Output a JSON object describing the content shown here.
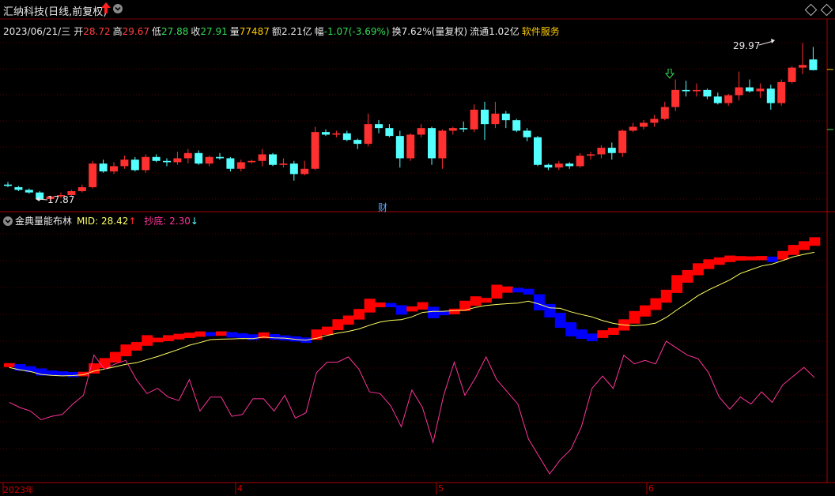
{
  "header": {
    "title": "汇纳科技(日线,前复权)",
    "arrow_up_icon": "red-up-arrow",
    "dropdown_icon": "chevron-down-icon"
  },
  "quote": {
    "date": "2023/06/21/三",
    "open_label": "开",
    "open": "28.72",
    "high_label": "高",
    "high": "29.67",
    "low_label": "低",
    "low": "27.88",
    "close_label": "收",
    "close": "27.91",
    "vol_label": "量",
    "vol": "77487",
    "amount_label": "额",
    "amount": "2.21亿",
    "change_label": "幅",
    "change": "-1.07(-3.69%)",
    "turnover": "换7.62%(量复权)",
    "float": "流通1.02亿",
    "sector": "软件服务"
  },
  "price_chart": {
    "max_label": "29.97",
    "min_label": "17.87",
    "event_badge": "财"
  },
  "indicator": {
    "name": "金典量能布林",
    "mid_label": "MID:",
    "mid_value": "28.42",
    "bottom_label": "抄底:",
    "bottom_value": "2.30"
  },
  "xaxis": {
    "labels": [
      "2023年",
      "4",
      "5",
      "6"
    ]
  },
  "colors": {
    "up": "#ff3030",
    "down": "#54ffff",
    "band_up": "#ff0000",
    "band_down": "#0000ff",
    "mid_line": "#ffff66",
    "bottom_line": "#ff3399",
    "grid": "#5a0000"
  },
  "chart_data": {
    "type": "candlestick",
    "candles": [
      [
        19.2,
        19.4,
        19.0,
        19.1
      ],
      [
        19.0,
        19.1,
        18.7,
        18.8
      ],
      [
        18.8,
        18.9,
        18.5,
        18.6
      ],
      [
        18.6,
        18.7,
        18.0,
        18.1
      ],
      [
        18.1,
        18.3,
        17.87,
        18.3
      ],
      [
        18.3,
        18.6,
        18.2,
        18.4
      ],
      [
        18.4,
        18.8,
        18.3,
        18.7
      ],
      [
        18.7,
        19.2,
        18.6,
        19.0
      ],
      [
        19.0,
        21.0,
        18.9,
        20.8
      ],
      [
        20.8,
        21.1,
        20.1,
        20.2
      ],
      [
        20.2,
        20.9,
        20.0,
        20.6
      ],
      [
        20.6,
        21.4,
        20.4,
        21.1
      ],
      [
        21.1,
        21.3,
        20.2,
        20.3
      ],
      [
        20.3,
        21.5,
        20.1,
        21.3
      ],
      [
        21.3,
        21.5,
        20.9,
        21.0
      ],
      [
        21.0,
        21.2,
        20.6,
        20.9
      ],
      [
        20.9,
        21.7,
        20.7,
        21.2
      ],
      [
        21.2,
        21.9,
        20.8,
        21.6
      ],
      [
        21.6,
        21.8,
        20.7,
        20.8
      ],
      [
        20.8,
        21.4,
        20.6,
        21.3
      ],
      [
        21.3,
        21.6,
        21.1,
        21.2
      ],
      [
        21.2,
        21.3,
        20.2,
        20.4
      ],
      [
        20.4,
        21.1,
        20.2,
        20.9
      ],
      [
        20.9,
        21.1,
        20.8,
        21.0
      ],
      [
        21.0,
        21.9,
        20.6,
        21.5
      ],
      [
        21.5,
        21.6,
        20.6,
        20.7
      ],
      [
        20.7,
        21.2,
        20.5,
        20.8
      ],
      [
        20.8,
        21.0,
        19.5,
        20.0
      ],
      [
        20.0,
        21.0,
        19.9,
        20.4
      ],
      [
        20.4,
        23.6,
        20.3,
        23.2
      ],
      [
        23.2,
        23.4,
        22.9,
        23.0
      ],
      [
        23.0,
        23.3,
        22.8,
        23.1
      ],
      [
        23.1,
        23.3,
        22.5,
        22.6
      ],
      [
        22.6,
        22.7,
        21.9,
        22.3
      ],
      [
        22.3,
        24.6,
        22.1,
        23.8
      ],
      [
        23.8,
        24.1,
        23.1,
        23.5
      ],
      [
        23.5,
        23.8,
        22.8,
        22.9
      ],
      [
        22.9,
        23.3,
        20.5,
        21.2
      ],
      [
        21.2,
        23.1,
        21.0,
        23.0
      ],
      [
        23.0,
        23.8,
        22.8,
        23.5
      ],
      [
        23.5,
        23.6,
        20.7,
        21.2
      ],
      [
        21.2,
        23.4,
        20.4,
        23.3
      ],
      [
        23.3,
        23.6,
        23.0,
        23.5
      ],
      [
        23.5,
        24.0,
        23.2,
        23.4
      ],
      [
        23.4,
        25.3,
        23.2,
        24.9
      ],
      [
        24.9,
        25.5,
        22.6,
        23.8
      ],
      [
        23.8,
        25.5,
        23.5,
        24.6
      ],
      [
        24.6,
        24.8,
        23.5,
        24.1
      ],
      [
        24.1,
        24.2,
        23.2,
        23.3
      ],
      [
        23.3,
        23.5,
        22.5,
        22.8
      ],
      [
        22.8,
        22.9,
        20.6,
        20.7
      ],
      [
        20.7,
        20.8,
        20.3,
        20.5
      ],
      [
        20.5,
        21.0,
        20.3,
        20.8
      ],
      [
        20.8,
        20.9,
        20.4,
        20.6
      ],
      [
        20.6,
        21.6,
        20.5,
        21.4
      ],
      [
        21.4,
        21.7,
        21.1,
        21.5
      ],
      [
        21.5,
        22.2,
        21.2,
        22.0
      ],
      [
        22.0,
        22.4,
        21.1,
        21.6
      ],
      [
        21.6,
        23.4,
        21.3,
        23.3
      ],
      [
        23.3,
        23.9,
        23.2,
        23.6
      ],
      [
        23.6,
        24.1,
        23.4,
        23.9
      ],
      [
        23.9,
        24.5,
        23.6,
        24.2
      ],
      [
        24.2,
        25.5,
        24.1,
        25.1
      ],
      [
        25.1,
        27.2,
        24.8,
        26.4
      ],
      [
        26.4,
        27.1,
        25.9,
        26.3
      ],
      [
        26.3,
        26.9,
        25.9,
        26.4
      ],
      [
        26.4,
        26.5,
        25.7,
        25.9
      ],
      [
        25.9,
        26.2,
        25.3,
        25.4
      ],
      [
        25.4,
        26.1,
        25.2,
        26.0
      ],
      [
        26.0,
        27.8,
        25.6,
        26.6
      ],
      [
        26.6,
        27.2,
        26.2,
        26.3
      ],
      [
        26.3,
        26.9,
        25.8,
        26.5
      ],
      [
        26.5,
        26.8,
        24.9,
        25.4
      ],
      [
        25.4,
        27.2,
        25.2,
        27.0
      ],
      [
        27.0,
        28.2,
        26.9,
        28.1
      ],
      [
        28.1,
        29.97,
        27.6,
        28.3
      ],
      [
        28.72,
        29.67,
        27.88,
        27.91
      ]
    ],
    "mid_values_normalized": "see script",
    "series": [
      {
        "name": "MID",
        "last": 28.42
      },
      {
        "name": "抄底",
        "last": 2.3
      }
    ]
  }
}
